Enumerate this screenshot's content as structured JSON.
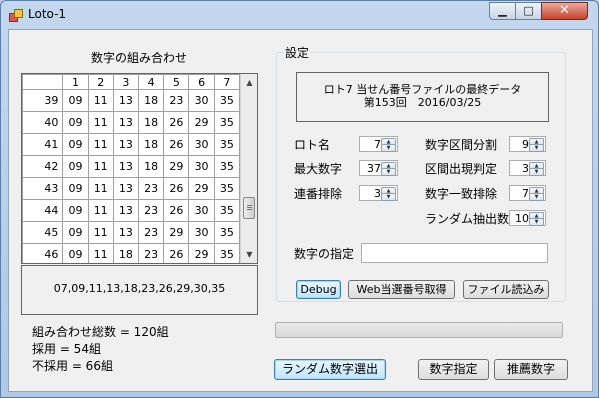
{
  "window": {
    "title": "Loto-1"
  },
  "grid": {
    "title": "数字の組み合わせ",
    "columns": [
      "1",
      "2",
      "3",
      "4",
      "5",
      "6",
      "7"
    ],
    "rows": [
      {
        "id": "39",
        "nums": [
          "09",
          "11",
          "13",
          "18",
          "23",
          "30",
          "35"
        ]
      },
      {
        "id": "40",
        "nums": [
          "09",
          "11",
          "13",
          "18",
          "26",
          "29",
          "35"
        ]
      },
      {
        "id": "41",
        "nums": [
          "09",
          "11",
          "13",
          "18",
          "26",
          "30",
          "35"
        ]
      },
      {
        "id": "42",
        "nums": [
          "09",
          "11",
          "13",
          "18",
          "29",
          "30",
          "35"
        ]
      },
      {
        "id": "43",
        "nums": [
          "09",
          "11",
          "13",
          "23",
          "26",
          "29",
          "35"
        ]
      },
      {
        "id": "44",
        "nums": [
          "09",
          "11",
          "13",
          "23",
          "26",
          "30",
          "35"
        ]
      },
      {
        "id": "45",
        "nums": [
          "09",
          "11",
          "13",
          "23",
          "29",
          "30",
          "35"
        ]
      },
      {
        "id": "46",
        "nums": [
          "09",
          "11",
          "18",
          "23",
          "26",
          "29",
          "35"
        ]
      }
    ]
  },
  "selected_combination": "07,09,11,13,18,23,26,29,30,35",
  "stats": {
    "total": "組み合わせ総数 = 120組",
    "adopted": "採用 = 54組",
    "rejected": "不採用 = 66組"
  },
  "settings": {
    "legend": "設定",
    "info_line1": "ロト7 当せん番号ファイルの最終データ",
    "info_line2": "第153回　2016/03/25",
    "loto_name": {
      "label": "ロト名",
      "value": "7"
    },
    "max_number": {
      "label": "最大数字",
      "value": "37"
    },
    "consecutive_exclusion": {
      "label": "連番排除",
      "value": "3"
    },
    "range_division": {
      "label": "数字区間分割",
      "value": "9"
    },
    "range_appearance": {
      "label": "区間出現判定",
      "value": "3"
    },
    "match_exclusion": {
      "label": "数字一致排除",
      "value": "7"
    },
    "random_extraction": {
      "label": "ランダム抽出数",
      "value": "10"
    },
    "number_specification": {
      "label": "数字の指定",
      "value": ""
    },
    "debug_button": "Debug",
    "web_fetch_button": "Web当選番号取得",
    "file_load_button": "ファイル読込み"
  },
  "progress": {
    "value": 0
  },
  "buttons": {
    "random_select": "ランダム数字選出",
    "number_spec": "数字指定",
    "recommend": "推薦数字"
  }
}
